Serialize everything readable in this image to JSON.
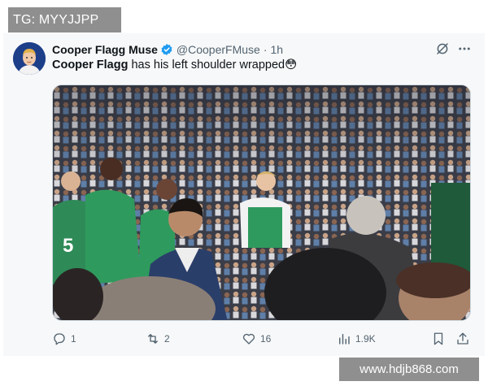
{
  "overlay": {
    "tg_label": "TG: MYYJJPP",
    "watermark": "www.hdjb868.com"
  },
  "tweet": {
    "display_name": "Cooper Flagg Muse",
    "handle": "@CooperFMuse",
    "separator": "·",
    "time": "1h",
    "text_mention": "Cooper Flagg",
    "text_rest": " has his left shoulder wrapped😳",
    "media_alt": "Photo of players in green jerseys standing in a crowded arena"
  },
  "stats": {
    "replies": "1",
    "reposts": "2",
    "likes": "16",
    "views": "1.9K"
  },
  "colors": {
    "verified": "#1d9bf0",
    "icon": "#536471",
    "card_bg": "#f7f8f9",
    "overlay": "#8f8f8f"
  },
  "icons": {
    "verified": "verified-badge-icon",
    "grok": "grok-icon",
    "more": "more-icon",
    "reply": "reply-icon",
    "repost": "repost-icon",
    "like": "heart-icon",
    "views": "views-icon",
    "bookmark": "bookmark-icon",
    "share": "share-icon"
  }
}
